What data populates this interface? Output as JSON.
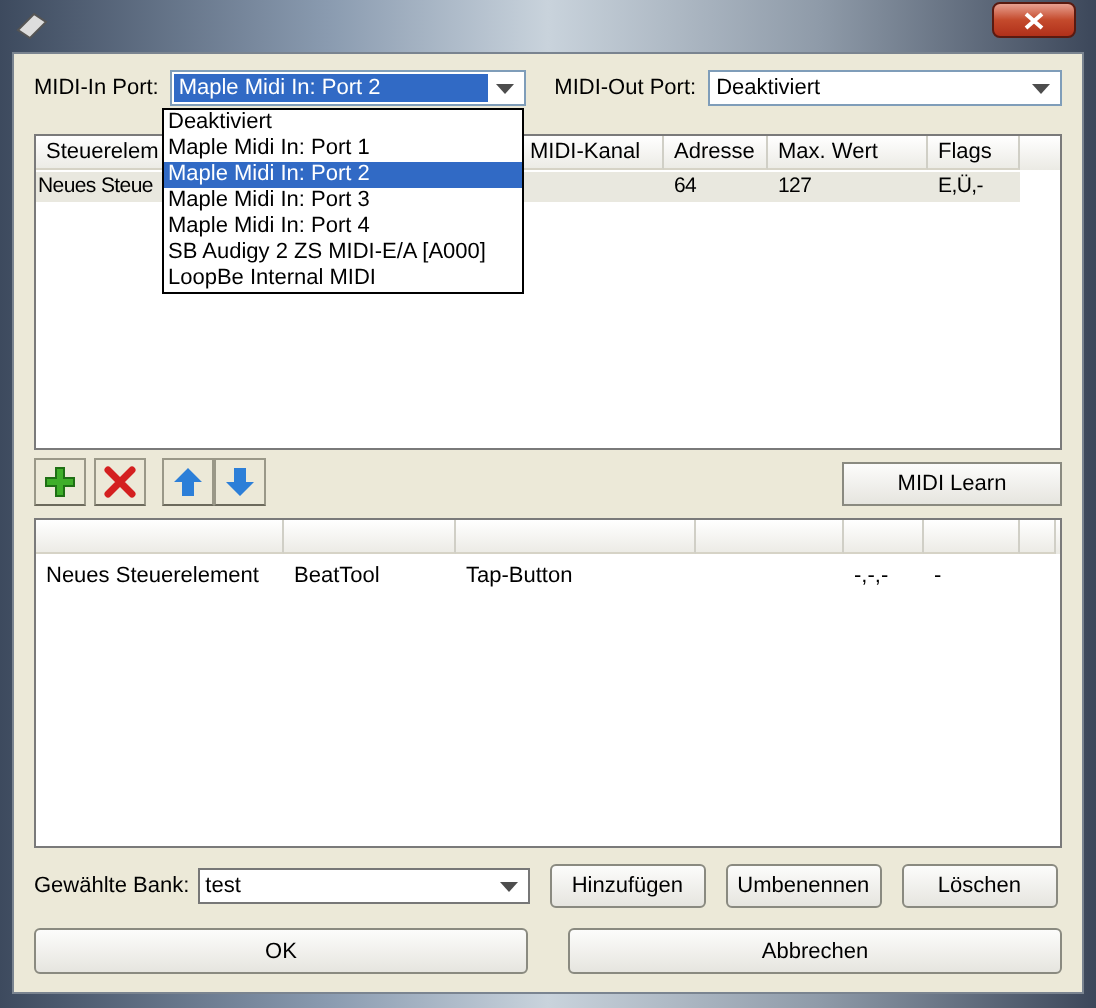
{
  "midi_in": {
    "label": "MIDI-In Port:",
    "value": "Maple Midi In: Port 2",
    "expanded": true,
    "options": [
      {
        "label": "Deaktiviert",
        "selected": false
      },
      {
        "label": "Maple Midi In: Port 1",
        "selected": false
      },
      {
        "label": "Maple Midi In: Port 2",
        "selected": true
      },
      {
        "label": "Maple Midi In: Port 3",
        "selected": false
      },
      {
        "label": "Maple Midi In: Port 4",
        "selected": false
      },
      {
        "label": "SB Audigy 2 ZS MIDI-E/A [A000]",
        "selected": false
      },
      {
        "label": "LoopBe Internal MIDI",
        "selected": false
      }
    ]
  },
  "midi_out": {
    "label": "MIDI-Out Port:",
    "value": "Deaktiviert"
  },
  "controls_table": {
    "columns": [
      "Steuerelem",
      "MIDI-Kanal",
      "Adresse",
      "Max. Wert",
      "Flags"
    ],
    "rows": [
      {
        "cells": [
          "Neues Steue",
          "",
          "64",
          "127",
          "E,Ü,-"
        ],
        "selected": true
      }
    ]
  },
  "toolbar": {
    "buttons": [
      {
        "kind": "add"
      },
      {
        "kind": "delete"
      },
      {
        "kind": "up"
      },
      {
        "kind": "down"
      }
    ],
    "learn": "MIDI Learn"
  },
  "mappings_table": {
    "rows": [
      {
        "cells": [
          "Neues Steuerelement",
          "BeatTool",
          "Tap-Button",
          "",
          "-,-,-",
          "-",
          ""
        ]
      }
    ]
  },
  "bank": {
    "label": "Gewählte Bank:",
    "value": "test",
    "buttons": [
      "Hinzufügen",
      "Umbenennen",
      "Löschen"
    ]
  },
  "buttons": [
    "OK",
    "Abbrechen"
  ]
}
